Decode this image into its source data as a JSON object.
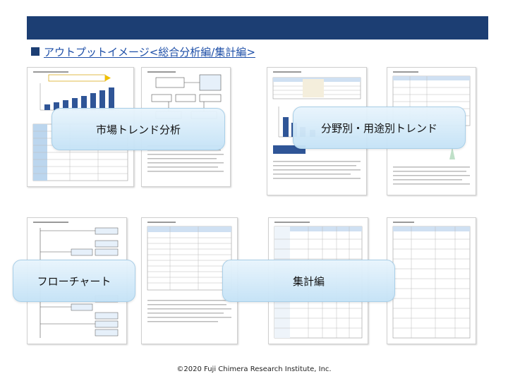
{
  "heading": {
    "text": "アウトプットイメージ<総合分析編/集計編>"
  },
  "callouts": {
    "market_trend": "市場トレンド分析",
    "by_field_use": "分野別・用途別トレンド",
    "flowchart": "フローチャート",
    "tabulation": "集計編"
  },
  "footer": {
    "copyright": "©2020 Fuji Chimera Research Institute, Inc."
  },
  "colors": {
    "header_bar": "#1c3e73",
    "heading_text": "#1e4fa8",
    "chart_bar": "#2f5597"
  }
}
